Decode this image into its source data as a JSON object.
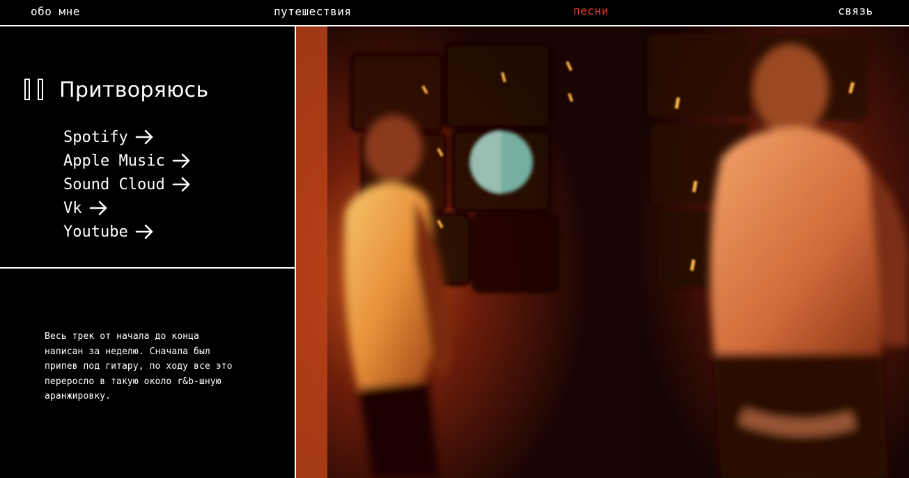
{
  "nav": {
    "items": [
      {
        "label": "обо мне",
        "active": false
      },
      {
        "label": "путешествия",
        "active": false
      },
      {
        "label": "песни",
        "active": true
      },
      {
        "label": "связь",
        "active": false
      }
    ],
    "active_color": "#e53a2a"
  },
  "song": {
    "title": "Притворяюсь",
    "play_state_icon": "pause-icon",
    "platforms": [
      {
        "label": "Spotify",
        "icon": "arrow-right-icon"
      },
      {
        "label": "Apple Music",
        "icon": "arrow-right-icon"
      },
      {
        "label": "Sound Cloud",
        "icon": "arrow-right-icon"
      },
      {
        "label": "Vk",
        "icon": "arrow-right-icon"
      },
      {
        "label": "Youtube",
        "icon": "arrow-right-icon"
      }
    ],
    "description": "Весь трек от начала до конца написан за неделю. Сначала был припев под гитару, по ходу все это переросло в такую около r&b-шную аранжировку."
  },
  "cover": {
    "handwritten_title": "Притворяюсь"
  }
}
